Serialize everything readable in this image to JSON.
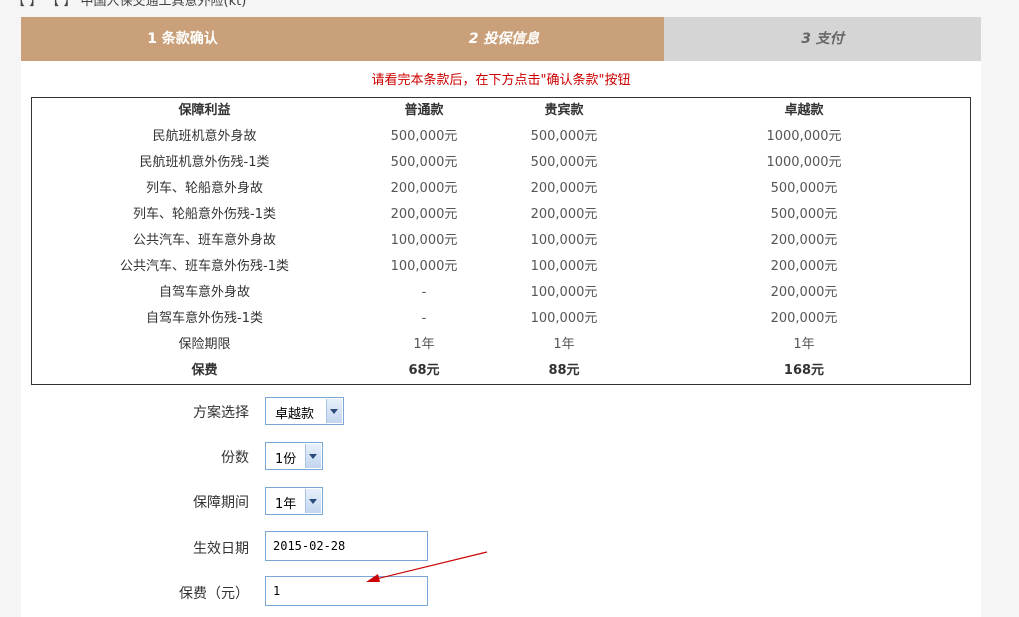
{
  "top_cut_text": "【 】 【 】 中国人保交通工具意外险(kt)",
  "steps": [
    {
      "label": "1 条款确认"
    },
    {
      "label": "2 投保信息"
    },
    {
      "label": "3 支付"
    }
  ],
  "notice": "请看完本条款后，在下方点击\"确认条款\"按钮",
  "table": {
    "headers": [
      "保障利益",
      "普通款",
      "贵宾款",
      "卓越款"
    ],
    "rows": [
      [
        "民航班机意外身故",
        "500,000元",
        "500,000元",
        "1000,000元"
      ],
      [
        "民航班机意外伤残-1类",
        "500,000元",
        "500,000元",
        "1000,000元"
      ],
      [
        "列车、轮船意外身故",
        "200,000元",
        "200,000元",
        "500,000元"
      ],
      [
        "列车、轮船意外伤残-1类",
        "200,000元",
        "200,000元",
        "500,000元"
      ],
      [
        "公共汽车、班车意外身故",
        "100,000元",
        "100,000元",
        "200,000元"
      ],
      [
        "公共汽车、班车意外伤残-1类",
        "100,000元",
        "100,000元",
        "200,000元"
      ],
      [
        "自驾车意外身故",
        "-",
        "100,000元",
        "200,000元"
      ],
      [
        "自驾车意外伤残-1类",
        "-",
        "100,000元",
        "200,000元"
      ],
      [
        "保险期限",
        "1年",
        "1年",
        "1年"
      ]
    ],
    "footer": [
      "保费",
      "68元",
      "88元",
      "168元"
    ]
  },
  "form": {
    "plan_label": "方案选择",
    "plan_value": "卓越款",
    "copies_label": "份数",
    "copies_value": "1份",
    "period_label": "保障期间",
    "period_value": "1年",
    "effective_label": "生效日期",
    "effective_value": "2015-02-28",
    "premium_label": "保费（元）",
    "premium_value": "1"
  },
  "colors": {
    "step_active": "#c9a079",
    "step_inactive": "#d5d5d5",
    "notice": "#cc0000",
    "arrow": "#cc0000"
  }
}
